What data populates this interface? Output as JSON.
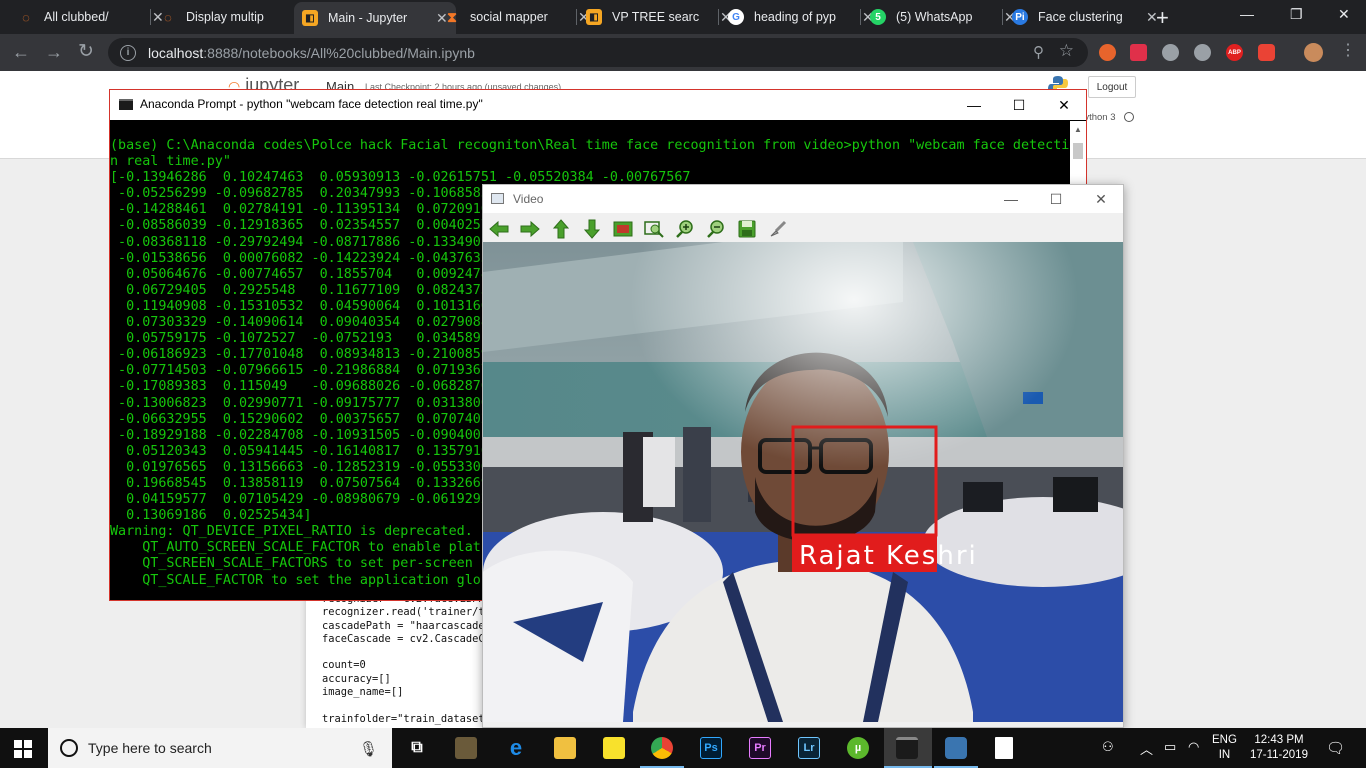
{
  "browser": {
    "tabs": [
      {
        "label": "All clubbed/",
        "icon": "jupyter-icon",
        "color": "#f37726"
      },
      {
        "label": "Display multip",
        "icon": "jupyter-icon",
        "color": "#f37726"
      },
      {
        "label": "Main - Jupyter",
        "icon": "jupyter-notebook-icon",
        "color": "#f5a623"
      },
      {
        "label": "social mapper",
        "icon": "hourglass-icon",
        "color": "#f37726"
      },
      {
        "label": "VP TREE searc",
        "icon": "jupyter-notebook-icon",
        "color": "#f5a623"
      },
      {
        "label": "heading of pyp",
        "icon": "google-icon",
        "color": "#4285f4"
      },
      {
        "label": "(5) WhatsApp",
        "icon": "whatsapp-icon",
        "color": "#25d366"
      },
      {
        "label": "Face clustering",
        "icon": "pyimagesearch-icon",
        "color": "#2a7ae2"
      }
    ],
    "whatsapp_badge": "5",
    "url_host": "localhost",
    "url_rest": ":8888/notebooks/All%20clubbed/Main.ipynb",
    "ext_abp": "ABP"
  },
  "jupyter": {
    "logo_text": "jupyter",
    "notebook_name": "Main",
    "checkpoint": "Last Checkpoint: 2 hours ago  (unsaved changes)",
    "logout": "Logout",
    "kernel": "Python 3",
    "code_lines": [
      "recognizer = cv2.face.LBPH",
      "recognizer.read('trainer/t",
      "cascadePath = \"haarcascade",
      "faceCascade = cv2.CascadeC",
      "",
      "count=0",
      "accuracy=[]",
      "image_name=[]",
      "",
      "trainfolder=\"train_dataset"
    ]
  },
  "anaconda": {
    "title": "Anaconda Prompt - python  \"webcam face detection real time.py\"",
    "console_lines": [
      "(base) C:\\Anaconda codes\\Polce hack Facial recogniton\\Real time face recognition from video>python \"webcam face detectio",
      "n real time.py\"",
      "[-0.13946286  0.10247463  0.05930913 -0.02615751 -0.05520384 -0.00767567",
      " -0.05256299 -0.09682785  0.20347993 -0.1068585",
      " -0.14288461  0.02784191 -0.11395134  0.0720916",
      " -0.08586039 -0.12918365  0.02354557  0.0040257",
      " -0.08368118 -0.29792494 -0.08717886 -0.1334901",
      " -0.01538656  0.00076082 -0.14223924 -0.0437635",
      "  0.05064676 -0.00774657  0.1855704   0.0092478",
      "  0.06729405  0.2925548   0.11677109  0.0824373",
      "  0.11940908 -0.15310532  0.04590064  0.1013166",
      "  0.07303329 -0.14090614  0.09040354  0.0279088",
      "  0.05759175 -0.1072527  -0.0752193   0.0345891",
      " -0.06186923 -0.17701048  0.08934813 -0.2100859",
      " -0.07714503 -0.07966615 -0.21986884  0.0719367",
      " -0.17089383  0.115049   -0.09688026 -0.0682876",
      " -0.13006823  0.02990771 -0.09175777  0.0313806",
      " -0.06632955  0.15290602  0.00375657  0.0707402",
      " -0.18929188 -0.02284708 -0.10931505 -0.0904001",
      "  0.05120343  0.05941445 -0.16140817  0.1357916",
      "  0.01976565  0.13156663 -0.12852319 -0.0553306",
      "  0.19668545  0.13858119  0.07507564  0.1332669",
      "  0.04159577  0.07105429 -0.08980679 -0.0619292",
      "  0.13069186  0.02525434]",
      "Warning: QT_DEVICE_PIXEL_RATIO is deprecated. I",
      "    QT_AUTO_SCREEN_SCALE_FACTOR to enable platf",
      "    QT_SCREEN_SCALE_FACTORS to set per-screen f",
      "    QT_SCALE_FACTOR to set the application glob"
    ]
  },
  "video": {
    "title": "Video",
    "face_label": "Rajat Keshri"
  },
  "taskbar": {
    "search_placeholder": "Type here to search",
    "lang_line1": "ENG",
    "lang_line2": "IN",
    "time": "12:43 PM",
    "date": "17-11-2019",
    "ps": "Ps",
    "pr": "Pr",
    "lr": "Lr"
  },
  "colors": {
    "console_green": "#16c60c",
    "face_box": "#e11c1c",
    "chrome_dark": "#202124"
  }
}
